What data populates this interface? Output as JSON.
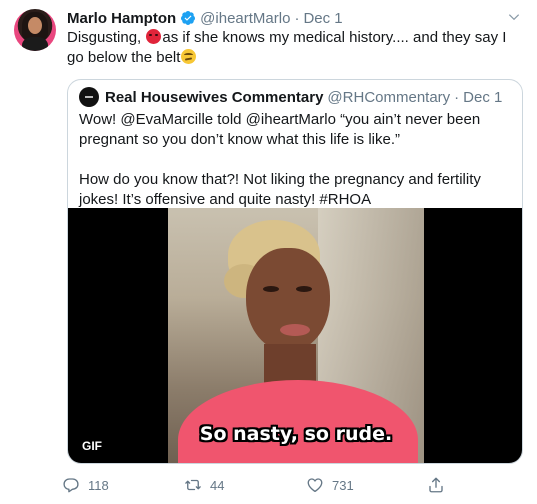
{
  "tweet": {
    "author_name": "Marlo Hampton",
    "author_handle": "@iheartMarlo",
    "separator": "·",
    "date": "Dec 1",
    "text_part1": "Disgusting,",
    "text_part2": "as if she knows my medical history.... and they say I go below the belt",
    "emoji_1": "angry-face",
    "emoji_2": "face-with-raised-eyebrow"
  },
  "quoted": {
    "author_name": "Real Housewives Commentary",
    "author_handle": "@RHCommentary",
    "separator": "·",
    "date": "Dec 1",
    "paragraph1": "Wow! @EvaMarcille told @iheartMarlo “you ain’t never been pregnant so you don’t know what this life is like.”",
    "paragraph2": "How do you know that?! Not liking the pregnancy and fertility jokes! It’s offensive and quite nasty! #RHOA",
    "media_caption": "So nasty, so rude.",
    "media_badge": "GIF"
  },
  "actions": {
    "reply_count": "118",
    "retweet_count": "44",
    "like_count": "731"
  },
  "colors": {
    "verified": "#1da1f2",
    "secondary_text": "#657786",
    "border": "#ccd6dd"
  },
  "icons": [
    "verified-badge-icon",
    "chevron-down-icon",
    "reply-icon",
    "retweet-icon",
    "like-icon",
    "share-icon"
  ]
}
